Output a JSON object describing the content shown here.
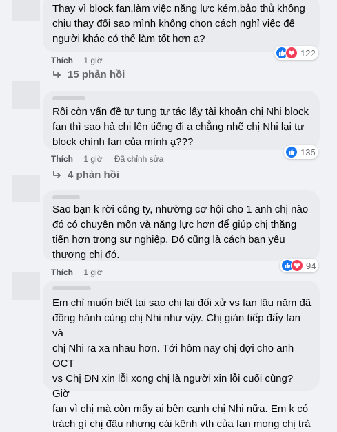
{
  "comments": [
    {
      "text": "Thay vì block fan,làm việc năng lực kém,bảo thủ không\nchịu thay đổi sao mình không chọn cách nghỉ việc để\nngười khác có thể làm tốt hơn ạ?",
      "like_label": "Thích",
      "time": "1 giờ",
      "reactions": [
        "like",
        "love"
      ],
      "reaction_count": "122",
      "replies": "15 phản hồi"
    },
    {
      "text": "Rồi còn vấn đề tự tung tự tác lấy tài khoản chị Nhi block\nfan thì sao hả chị lên tiếng đi ạ chẳng nhẽ chị Nhi lại tự\nblock chính fan của mình ạ???",
      "like_label": "Thích",
      "time": "1 giờ",
      "edited": "Đã chỉnh sửa",
      "reactions": [
        "like"
      ],
      "reaction_count": "135",
      "replies": "4 phản hồi"
    },
    {
      "text": "Sao bạn k rời công ty, nhường cơ hội cho 1 anh chị nào\nđó có chuyên môn và năng lực hơn để giúp chị thăng\ntiến hơn trong sự nghiệp. Đó cũng là cách bạn yêu\nthương chị đó.",
      "like_label": "Thích",
      "time": "1 giờ",
      "reactions": [
        "like",
        "love"
      ],
      "reaction_count": "94"
    },
    {
      "text": "Em chỉ muốn biết tại sao chị lại đối xử vs fan lâu năm đã\nđồng hành cùng chị Nhi như vậy. Chị gián tiếp đẩy fan và\nchị Nhi ra xa nhau hơn. Tới hôm nay chị đợi cho anh OCT\nvs Chị ĐN xin lỗi xong chị là người xin lỗi cuối cùng? Giờ\nfan vì chị mà còn mấy ai bên cạnh chị Nhi nữa. Em k có\ntrách gì chị đâu nhưng cái kênh vth của fan mong chị trả"
    }
  ],
  "colors": {
    "accent": "#1877f2",
    "love": "#f33e58",
    "secondary_text": "#65676b"
  }
}
